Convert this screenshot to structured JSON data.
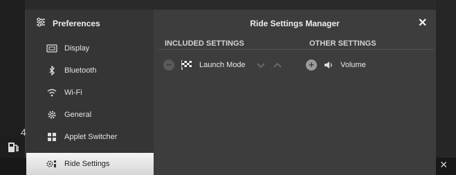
{
  "background": {
    "side_number": "4",
    "fuel_icon": "fuel-pump-icon",
    "close_symbol": "×"
  },
  "sidebar": {
    "title": "Preferences",
    "title_icon": "preferences-sliders-icon",
    "items": [
      {
        "label": "Display",
        "icon": "display-icon"
      },
      {
        "label": "Bluetooth",
        "icon": "bluetooth-icon"
      },
      {
        "label": "Wi-Fi",
        "icon": "wifi-icon"
      },
      {
        "label": "General",
        "icon": "gear-icon"
      },
      {
        "label": "Applet Switcher",
        "icon": "applet-switcher-icon"
      },
      {
        "label": "Ride Settings",
        "icon": "ride-settings-icon",
        "selected": true
      }
    ]
  },
  "main": {
    "title": "Ride Settings Manager",
    "close_symbol": "✕",
    "included": {
      "header": "INCLUDED SETTINGS",
      "items": [
        {
          "label": "Launch Mode",
          "icon": "checkered-flag-icon",
          "action": "minus"
        }
      ]
    },
    "other": {
      "header": "OTHER SETTINGS",
      "items": [
        {
          "label": "Volume",
          "icon": "speaker-icon",
          "action": "plus"
        }
      ]
    },
    "minus_symbol": "−",
    "plus_symbol": "+"
  },
  "colors": {
    "panel": "#3d3d3d",
    "sidebar": "#353535",
    "selected_bg": "#e6e6e6",
    "text": "#e8e8e8"
  }
}
